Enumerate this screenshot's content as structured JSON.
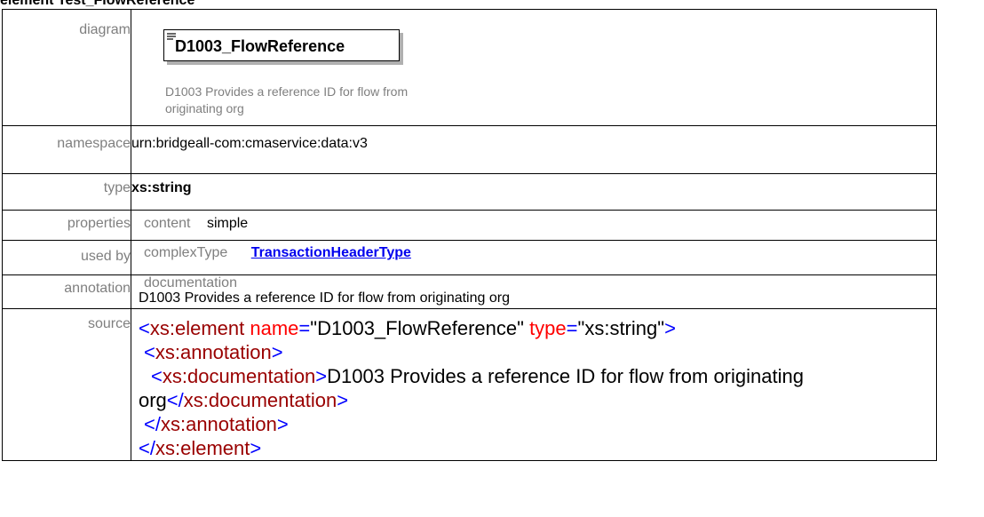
{
  "heading": "element Test_FlowReference",
  "labels": {
    "diagram": "diagram",
    "namespace": "namespace",
    "type": "type",
    "properties": "properties",
    "used_by": "used by",
    "annotation": "annotation",
    "source": "source"
  },
  "diagram": {
    "element_name": "D1003_FlowReference",
    "documentation": "D1003 Provides a reference ID for flow from originating org"
  },
  "namespace": "urn:bridgeall-com:cmaservice:data:v3",
  "type": "xs:string",
  "properties": {
    "key": "content",
    "value": "simple"
  },
  "used_by": {
    "kind": "complexType",
    "link": "TransactionHeaderType"
  },
  "annotation": {
    "heading": "documentation",
    "text": "D1003 Provides a reference ID for flow from originating org"
  },
  "source": {
    "lt": "<",
    "lt_slash": "</",
    "gt": ">",
    "eq": "=",
    "quote": "\"",
    "element_tag": "xs:element",
    "attr_name": "name",
    "attr_name_value": "D1003_FlowReference",
    "attr_type": "type",
    "attr_type_value": "xs:string",
    "annotation_tag": "xs:annotation",
    "documentation_tag": "xs:documentation",
    "documentation_text_line1": "D1003 Provides a reference ID for flow from originating",
    "documentation_text_line2": "org"
  },
  "colors": {
    "label_gray": "#7f7f7f",
    "link_blue": "#0000ee",
    "xml_bracket_blue": "#0000ff",
    "xml_element_maroon": "#990000",
    "xml_attr_red": "#ff0000"
  }
}
